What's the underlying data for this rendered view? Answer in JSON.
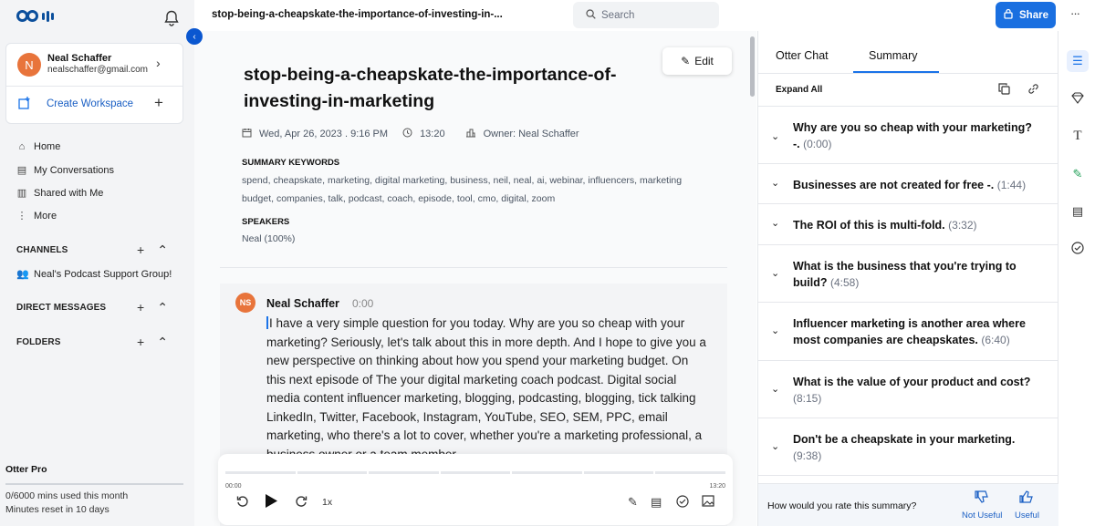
{
  "sidebar": {
    "profile": {
      "initial": "N",
      "name": "Neal Schaffer",
      "email": "nealschaffer@gmail.com"
    },
    "create_workspace": "Create Workspace",
    "nav": [
      {
        "label": "Home",
        "icon": "home-icon"
      },
      {
        "label": "My Conversations",
        "icon": "conversations-icon"
      },
      {
        "label": "Shared with Me",
        "icon": "shared-icon"
      },
      {
        "label": "More",
        "icon": "more-vertical-icon"
      }
    ],
    "channels_label": "CHANNELS",
    "channel_item": "Neal's Podcast Support Group!",
    "direct_messages_label": "DIRECT MESSAGES",
    "folders_label": "FOLDERS",
    "plan": {
      "name": "Otter Pro",
      "usage": "0/6000 mins used this month",
      "reset": "Minutes reset in 10 days",
      "used_fraction": 0
    }
  },
  "topbar": {
    "doc_title": "stop-being-a-cheapskate-the-importance-of-investing-in-...",
    "search_placeholder": "Search",
    "share_label": "Share",
    "more": "···"
  },
  "main": {
    "edit_label": "Edit",
    "title": "stop-being-a-cheapskate-the-importance-of-investing-in-marketing",
    "date": "Wed, Apr 26, 2023 . 9:16 PM",
    "duration": "13:20",
    "owner": "Owner: Neal Schaffer",
    "keywords_label": "SUMMARY KEYWORDS",
    "keywords": "spend,  cheapskate,  marketing,  digital marketing,  business,  neil,  neal,  ai,  webinar,  influencers,  marketing budget,  companies,  talk,  podcast,  coach,  episode,  tool,  cmo,  digital,  zoom",
    "speakers_label": "SPEAKERS",
    "speakers": "Neal (100%)",
    "transcript": {
      "initials": "NS",
      "speaker": "Neal Schaffer",
      "time": "0:00",
      "text": "I have a very simple question for you today. Why are you so cheap with your marketing? Seriously, let's talk about this in more depth. And I hope to give you a new perspective on thinking about how you spend your marketing budget. On this next episode of The your digital marketing coach podcast. Digital social media content influencer marketing, blogging, podcasting, blogging, tick talking LinkedIn, Twitter, Facebook, Instagram, YouTube, SEO, SEM, PPC, email marketing, who there's a lot to cover, whether you're a marketing professional, a business owner or a team member"
    },
    "player": {
      "start": "00:00",
      "end": "13:20",
      "speed": "1x",
      "position_fraction": 0
    }
  },
  "right_panel": {
    "tabs": [
      "Otter Chat",
      "Summary"
    ],
    "active_tab": "Summary",
    "expand_all": "Expand All",
    "summary_items": [
      {
        "title": "Why are you so cheap with your marketing? -.",
        "time": "(0:00)"
      },
      {
        "title": "Businesses are not created for free -.",
        "time": "(1:44)"
      },
      {
        "title": "The ROI of this is multi-fold.",
        "time": "(3:32)"
      },
      {
        "title": "What is the business that you're trying to build?",
        "time": "(4:58)"
      },
      {
        "title": "Influencer marketing is another area where most companies are cheapskates.",
        "time": "(6:40)"
      },
      {
        "title": "What is the value of your product and cost?",
        "time": "(8:15)"
      },
      {
        "title": "Don't be a cheapskate in your marketing.",
        "time": "(9:38)"
      }
    ],
    "rating_question": "How would you rate this summary?",
    "not_useful": "Not Useful",
    "useful": "Useful"
  },
  "rail_icons": [
    "outline-icon",
    "diamond-icon",
    "text-icon",
    "highlight-icon",
    "comment-icon",
    "check-icon"
  ],
  "colors": {
    "accent": "#1a73e8",
    "avatar": "#e8743b",
    "share": "#1a6fe0"
  }
}
